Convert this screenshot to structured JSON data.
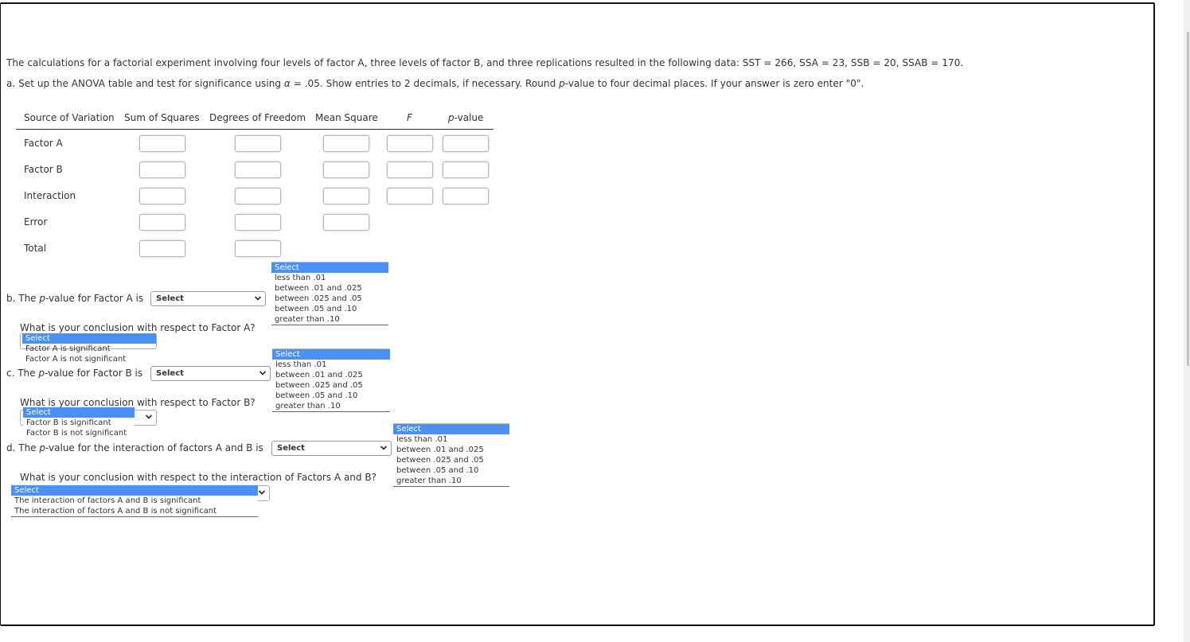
{
  "intro": {
    "text": "The calculations for a factorial experiment involving four levels of factor A, three levels of factor B, and three replications resulted in the following data: SST = 266, SSA = 23, SSB = 20, SSAB = 170."
  },
  "part_a": {
    "prefix": "a. Set up the ANOVA table and test for significance using ",
    "alpha_symbol": "α",
    "middle": " = .05. Show entries to 2 decimals, if necessary. Round ",
    "p_symbol": "p",
    "suffix": "-value to four decimal places. If your answer is zero enter \"0\"."
  },
  "anova_table": {
    "headers": {
      "source": "Source of Variation",
      "ss": "Sum of Squares",
      "df": "Degrees of Freedom",
      "ms": "Mean Square",
      "f": "F",
      "p_italic": "p",
      "p_rest": "-value"
    },
    "rows": [
      {
        "label": "Factor A",
        "ss": "",
        "df": "",
        "ms": "",
        "f": "",
        "p": ""
      },
      {
        "label": "Factor B",
        "ss": "",
        "df": "",
        "ms": "",
        "f": "",
        "p": ""
      },
      {
        "label": "Interaction",
        "ss": "",
        "df": "",
        "ms": "",
        "f": "",
        "p": ""
      },
      {
        "label": "Error",
        "ss": "",
        "df": "",
        "ms": ""
      },
      {
        "label": "Total",
        "ss": "",
        "df": ""
      }
    ]
  },
  "pvalue_options": [
    "Select",
    "less than .01",
    "between .01 and .025",
    "between .025 and .05",
    "between .05 and .10",
    "greater than .10"
  ],
  "part_b": {
    "prefix": "b. The ",
    "p_symbol": "p",
    "suffix": "-value for Factor A is",
    "selected": "Select",
    "conclusion_question": "What is your conclusion with respect to Factor A?",
    "conclusion_options": [
      "Select",
      "Factor A is significant",
      "Factor A is not significant"
    ]
  },
  "part_c": {
    "prefix": "c. The ",
    "p_symbol": "p",
    "suffix": "-value for Factor B is",
    "selected": "Select",
    "conclusion_question": "What is your conclusion with respect to Factor B?",
    "conclusion_options": [
      "Select",
      "Factor B is significant",
      "Factor B is not significant"
    ]
  },
  "part_d": {
    "prefix": "d. The ",
    "p_symbol": "p",
    "suffix": "-value for the interaction of factors A and B is",
    "selected": "Select",
    "conclusion_question": "What is your conclusion with respect to the interaction of Factors A and B?",
    "conclusion_options": [
      "Select",
      "The interaction of factors A and B is significant",
      "The interaction of factors A and B is not significant"
    ]
  },
  "colors": {
    "highlight": "#4a90f5",
    "frame_border": "#111111",
    "text": "#333333"
  }
}
